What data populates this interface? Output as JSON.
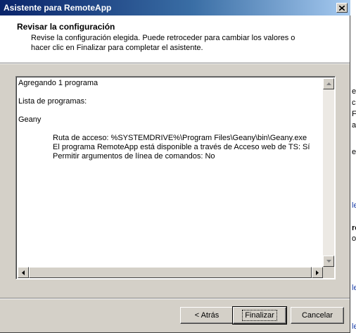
{
  "window": {
    "title": "Asistente para RemoteApp"
  },
  "header": {
    "title": "Revisar la configuración",
    "description_line1": "Revise la configuración elegida. Puede retroceder para cambiar los valores o",
    "description_line2": "hacer clic en Finalizar para completar el asistente."
  },
  "summary": {
    "lines": [
      "Agregando 1 programa",
      "",
      "Lista de programas:",
      "",
      "Geany"
    ],
    "details": [
      "Ruta de acceso: %SYSTEMDRIVE%\\Program Files\\Geany\\bin\\Geany.exe",
      "El programa RemoteApp está disponible a través de Acceso web de TS: Sí",
      "Permitir argumentos de línea de comandos: No"
    ]
  },
  "buttons": {
    "back": "< Atrás",
    "finish": "Finalizar",
    "cancel": "Cancelar"
  },
  "background": {
    "fragments": [
      "e",
      "c",
      "F",
      "a",
      "e",
      "le",
      "ro",
      "o",
      "le",
      "le"
    ]
  }
}
